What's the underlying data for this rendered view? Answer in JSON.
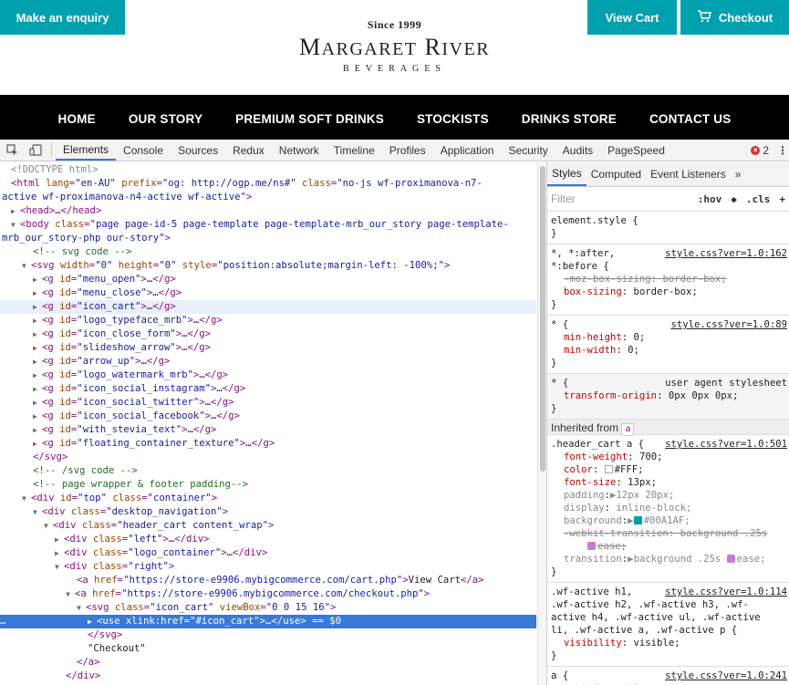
{
  "site": {
    "enquiry_label": "Make an enquiry",
    "view_cart_label": "View Cart",
    "checkout_label": "Checkout",
    "logo": {
      "since": "Since 1999",
      "name": "Margaret River",
      "sub": "BEVERAGES"
    },
    "nav": [
      "HOME",
      "OUR STORY",
      "PREMIUM SOFT DRINKS",
      "STOCKISTS",
      "DRINKS STORE",
      "CONTACT US"
    ],
    "colors": {
      "accent": "#00A1AF",
      "nav_bg": "#000000"
    }
  },
  "devtools": {
    "tabs": [
      "Elements",
      "Console",
      "Sources",
      "Redux",
      "Network",
      "Timeline",
      "Profiles",
      "Application",
      "Security",
      "Audits",
      "PageSpeed"
    ],
    "active_tab": "Elements",
    "error_count": "2",
    "styles_tabs": [
      "Styles",
      "Computed",
      "Event Listeners",
      "»"
    ],
    "filter_placeholder": "Filter",
    "filter_hov": ":hov",
    "filter_cls": ".cls",
    "filter_plus": "+",
    "inherited_from": "Inherited from",
    "inherited_tag": "a",
    "selected_suffix": "== $0"
  }
}
